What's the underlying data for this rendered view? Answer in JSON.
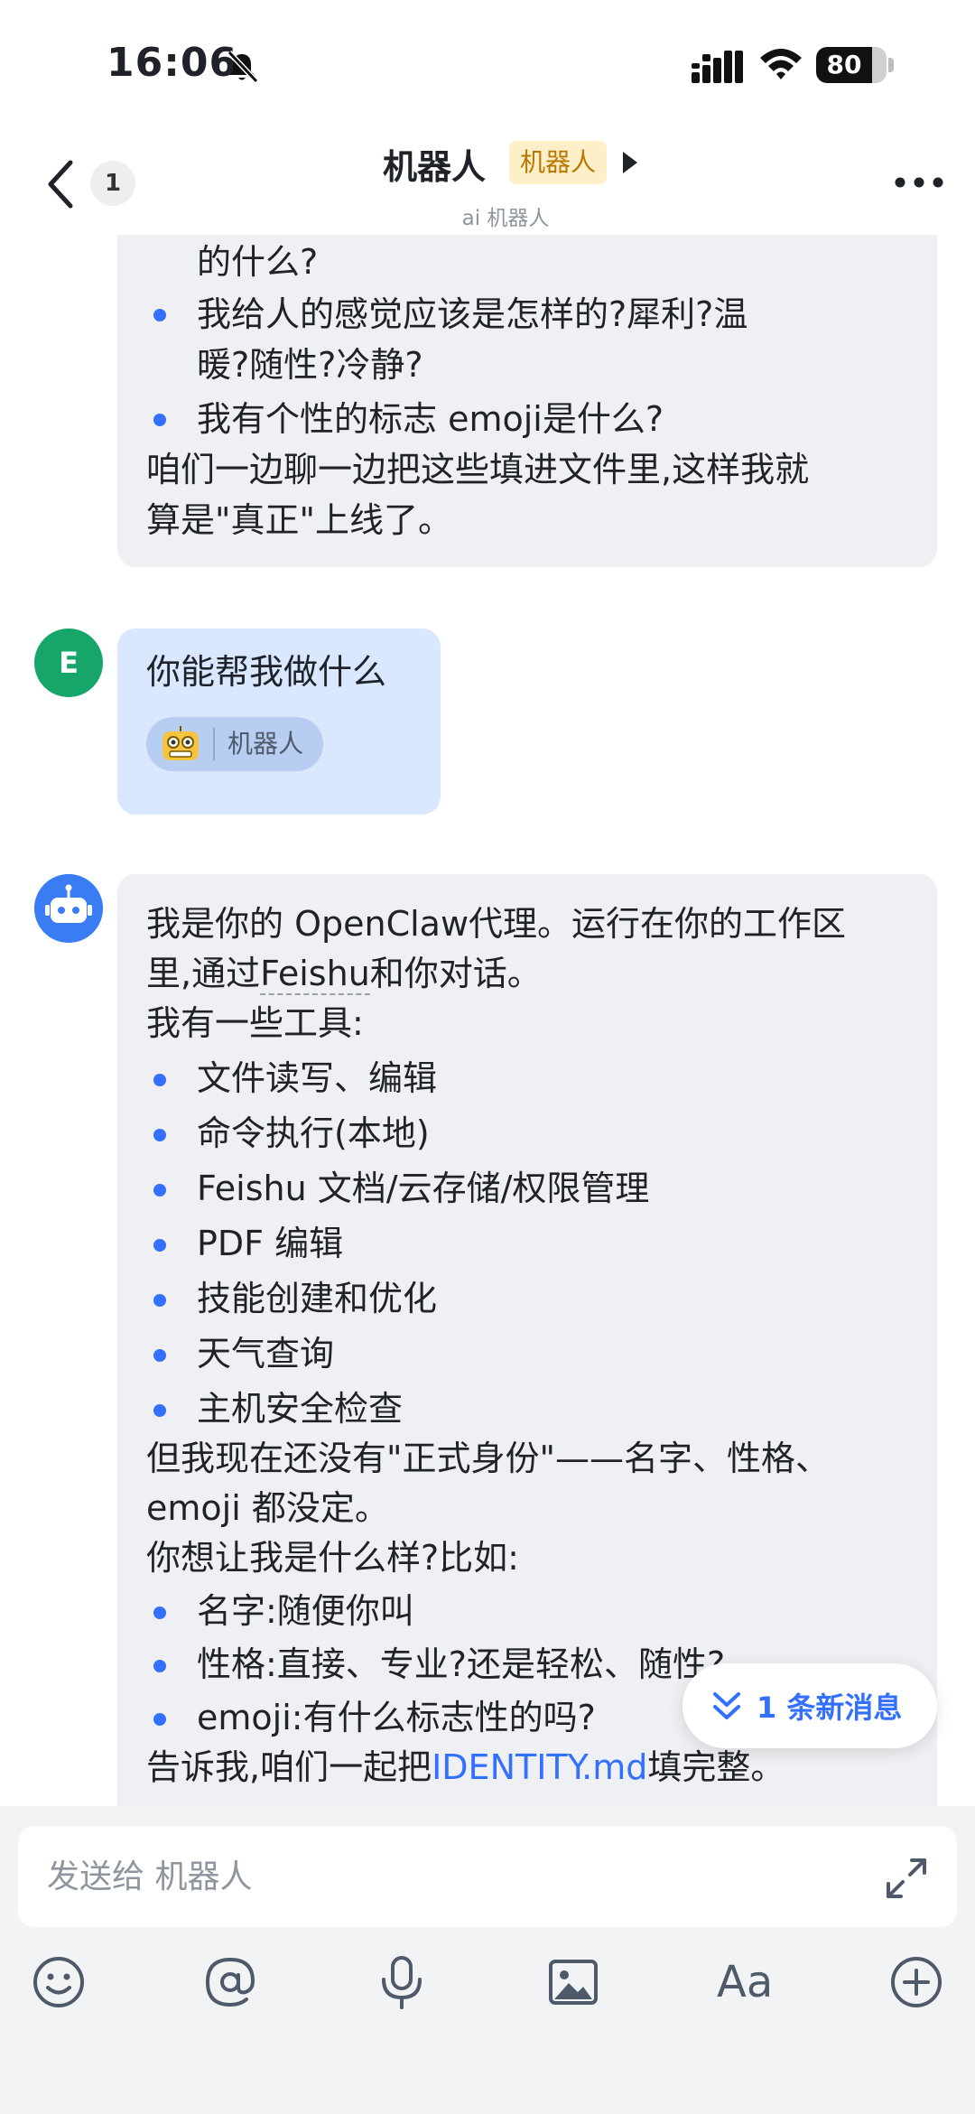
{
  "status_bar": {
    "time": "16:06",
    "battery_level": "80",
    "battery_fraction": 0.8
  },
  "header": {
    "back_badge": "1",
    "title": "机器人",
    "tag": "机器人",
    "subtitle": "ai 机器人"
  },
  "messages": {
    "bot_message_1": {
      "lines": [
        "的什么?",
        "我给人的感觉应该是怎样的?犀利?温",
        "暖?随性?冷静?",
        "我有个性的标志 emoji是什么?",
        "咱们一边聊一边把这些填进文件里,这样我就",
        "算是\"真正\"上线了。"
      ]
    },
    "user_message": {
      "avatar_letter": "E",
      "text": "你能帮我做什么",
      "mention_label": "机器人"
    },
    "bot_message_2": {
      "intro_line_1": "我是你的 OpenClaw代理。运行在你的工作区",
      "intro_line_2_prefix": "里,通过",
      "intro_line_2_link": "Feishu",
      "intro_line_2_suffix": "和你对话。",
      "tools_heading": "我有一些工具:",
      "tools": [
        "文件读写、编辑",
        "命令执行(本地)",
        "Feishu 文档/云存储/权限管理",
        "PDF 编辑",
        "技能创建和优化",
        "天气查询",
        "主机安全检查"
      ],
      "identity_line_1": "但我现在还没有\"正式身份\"——名字、性格、",
      "identity_line_2": "emoji 都没定。",
      "question": "你想让我是什么样?比如:",
      "options": [
        "名字:随便你叫",
        "性格:直接、专业?还是轻松、随性?",
        "emoji:有什么标志性的吗?"
      ],
      "closing_prefix": "告诉我,咱们一起把",
      "closing_link": "IDENTITY.md",
      "closing_suffix": "填完整。"
    },
    "new_message_pill": "1 条新消息"
  },
  "composer": {
    "placeholder": "发送给 机器人",
    "font_button": "Aa"
  },
  "icons": {
    "mute": "bell-slash-icon",
    "signal": "cellular-signal-icon",
    "wifi": "wifi-icon",
    "back": "chevron-left-icon",
    "more": "more-dots-icon",
    "expand": "expand-icon",
    "emoji": "emoji-icon",
    "mention": "at-icon",
    "voice": "microphone-icon",
    "image": "image-icon",
    "font": "font-icon",
    "add": "plus-circle-icon"
  },
  "colors": {
    "accent": "#3370ff",
    "bot_bubble": "#eef0f3",
    "user_bubble": "#d9e7ff",
    "tag_bg": "#fdf0c8",
    "tag_text": "#b87800",
    "user_avatar": "#17a66a",
    "bot_avatar": "#3a7cf4"
  }
}
